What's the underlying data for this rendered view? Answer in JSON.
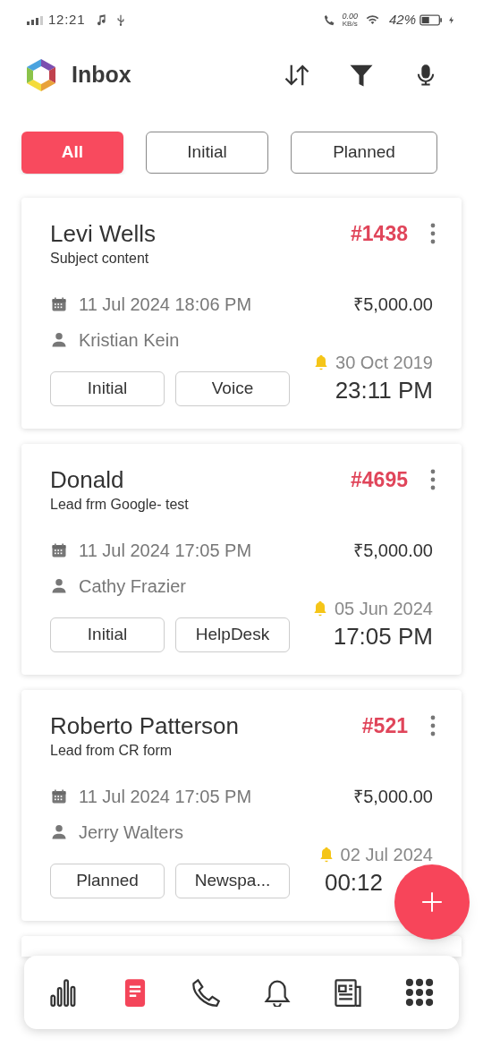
{
  "status_bar": {
    "time": "12:21",
    "speed": "0.00",
    "speed_unit": "KB/s",
    "battery": "42%"
  },
  "header": {
    "title": "Inbox"
  },
  "filters": [
    {
      "label": "All",
      "selected": true
    },
    {
      "label": "Initial",
      "selected": false
    },
    {
      "label": "Planned",
      "selected": false
    }
  ],
  "leads": [
    {
      "name": "Levi Wells",
      "subject": "Subject content",
      "number": "#1438",
      "created": "11 Jul 2024 18:06 PM",
      "amount": "₹5,000.00",
      "assignee": "Kristian Kein",
      "reminder_date": "30 Oct 2019",
      "reminder_time": "23:11 PM",
      "tags": [
        "Initial",
        "Voice"
      ]
    },
    {
      "name": "Donald",
      "subject": "Lead frm Google- test",
      "number": "#4695",
      "created": "11 Jul 2024 17:05 PM",
      "amount": "₹5,000.00",
      "assignee": "Cathy Frazier",
      "reminder_date": "05 Jun 2024",
      "reminder_time": "17:05 PM",
      "tags": [
        "Initial",
        "HelpDesk"
      ]
    },
    {
      "name": "Roberto Patterson",
      "subject": "Lead from CR form",
      "number": "#521",
      "created": "11 Jul 2024 17:05 PM",
      "amount": "₹5,000.00",
      "assignee": "Jerry Walters",
      "reminder_date": "02 Jul 2024",
      "reminder_time": "00:12",
      "tags": [
        "Planned",
        "Newspa..."
      ]
    }
  ],
  "bottom_nav": [
    {
      "kind": "reports",
      "selected": false
    },
    {
      "kind": "leads",
      "selected": true
    },
    {
      "kind": "calls",
      "selected": false
    },
    {
      "kind": "reminders",
      "selected": false
    },
    {
      "kind": "news",
      "selected": false
    },
    {
      "kind": "apps",
      "selected": false
    }
  ]
}
